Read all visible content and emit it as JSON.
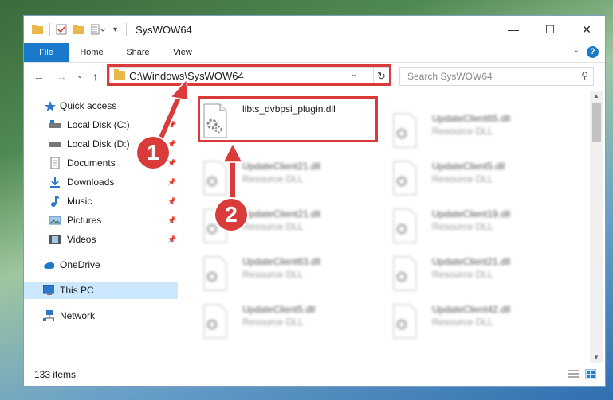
{
  "window": {
    "title": "SysWOW64",
    "controls": {
      "minimize": "—",
      "maximize": "☐",
      "close": "✕"
    }
  },
  "ribbon": {
    "tabs": [
      "File",
      "Home",
      "Share",
      "View"
    ],
    "help": "?",
    "expand": "⌄"
  },
  "address": {
    "path": "C:\\Windows\\SysWOW64",
    "dropdown": "⌄",
    "refresh": "↻"
  },
  "search": {
    "placeholder": "Search SysWOW64",
    "icon": "⚲"
  },
  "sidebar": {
    "items": [
      {
        "label": "Quick access",
        "icon": "star-icon"
      },
      {
        "label": "Local Disk (C:)",
        "icon": "drive-icon"
      },
      {
        "label": "Local Disk (D:)",
        "icon": "drive-icon"
      },
      {
        "label": "Documents",
        "icon": "document-icon"
      },
      {
        "label": "Downloads",
        "icon": "download-icon"
      },
      {
        "label": "Music",
        "icon": "music-icon"
      },
      {
        "label": "Pictures",
        "icon": "pictures-icon"
      },
      {
        "label": "Videos",
        "icon": "videos-icon"
      },
      {
        "label": "OneDrive",
        "icon": "cloud-icon"
      },
      {
        "label": "This PC",
        "icon": "computer-icon"
      },
      {
        "label": "Network",
        "icon": "network-icon"
      }
    ],
    "pin": "📌"
  },
  "files": [
    {
      "name": "libts_dvbpsi_plugin.dll",
      "type": ""
    },
    {
      "name": "UpdateClient65.dll",
      "type": "Resource DLL"
    },
    {
      "name": "UpdateClient21.dll",
      "type": "Resource DLL"
    },
    {
      "name": "UpdateClient5.dll",
      "type": "Resource DLL"
    },
    {
      "name": "UpdateClient21.dll",
      "type": "Resource DLL"
    },
    {
      "name": "UpdateClient19.dll",
      "type": "Resource DLL"
    },
    {
      "name": "UpdateClient63.dll",
      "type": "Resource DLL"
    },
    {
      "name": "UpdateClient21.dll",
      "type": "Resource DLL"
    },
    {
      "name": "UpdateClient5.dll",
      "type": "Resource DLL"
    },
    {
      "name": "UpdateClient42.dll",
      "type": "Resource DLL"
    }
  ],
  "status": {
    "count": "133 items"
  },
  "annotations": {
    "step1": "1",
    "step2": "2",
    "color": "#d93a3a"
  },
  "colors": {
    "accent": "#1979ca",
    "selected": "#cce8ff",
    "highlight": "#d93a3a"
  }
}
